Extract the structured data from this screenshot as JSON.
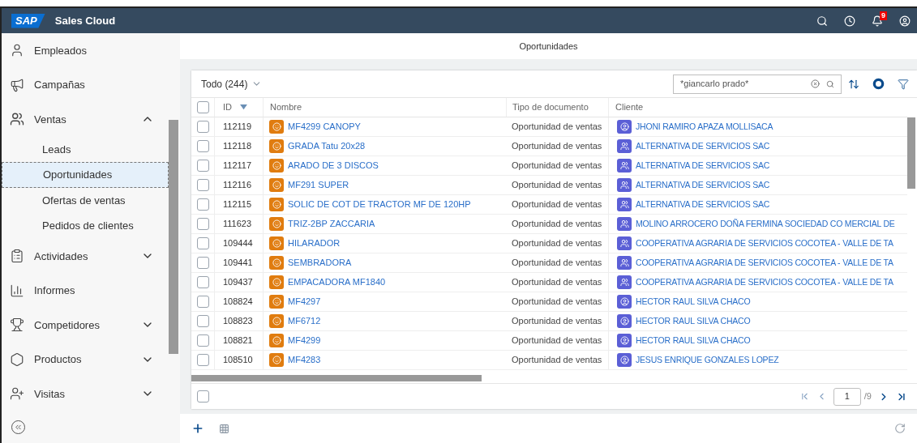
{
  "header": {
    "logo": "SAP",
    "title": "Sales Cloud",
    "notifications_count": "9"
  },
  "sidebar": {
    "items": [
      {
        "label": "Empleados",
        "selected": false
      },
      {
        "label": "Campañas",
        "selected": false
      },
      {
        "label": "Ventas",
        "selected": false,
        "expanded": true,
        "children": [
          {
            "label": "Leads",
            "selected": false
          },
          {
            "label": "Oportunidades",
            "selected": true
          },
          {
            "label": "Ofertas de ventas",
            "selected": false
          },
          {
            "label": "Pedidos de clientes",
            "selected": false
          }
        ]
      },
      {
        "label": "Actividades",
        "selected": false,
        "expanded": false
      },
      {
        "label": "Informes",
        "selected": false
      },
      {
        "label": "Competidores",
        "selected": false,
        "expanded": false
      },
      {
        "label": "Productos",
        "selected": false,
        "expanded": false
      },
      {
        "label": "Visitas",
        "selected": false,
        "expanded": false
      }
    ]
  },
  "page_title": "Oportunidades",
  "list": {
    "view": "Todo",
    "count": "(244)",
    "search": {
      "value": "*giancarlo prado*"
    },
    "columns": [
      "ID",
      "Nombre",
      "Tipo de documento",
      "Cliente"
    ],
    "header_checkbox": {
      "checked": false
    },
    "footer_checkbox": {
      "checked": false
    },
    "rows": [
      {
        "id": "112119",
        "name": "MF4299 CANOPY",
        "type": "Oportunidad de ventas",
        "client": "JHONI RAMIRO APAZA MOLLISACA",
        "kind": "person",
        "checked": false
      },
      {
        "id": "112118",
        "name": "GRADA Tatu 20x28",
        "type": "Oportunidad de ventas",
        "client": "ALTERNATIVA DE SERVICIOS SAC",
        "kind": "account",
        "checked": false
      },
      {
        "id": "112117",
        "name": "ARADO DE 3 DISCOS",
        "type": "Oportunidad de ventas",
        "client": "ALTERNATIVA DE SERVICIOS SAC",
        "kind": "account",
        "checked": false
      },
      {
        "id": "112116",
        "name": "MF291 SUPER",
        "type": "Oportunidad de ventas",
        "client": "ALTERNATIVA DE SERVICIOS SAC",
        "kind": "account",
        "checked": false
      },
      {
        "id": "112115",
        "name": "SOLIC DE COT DE TRACTOR MF DE 120HP",
        "type": "Oportunidad de ventas",
        "client": "ALTERNATIVA DE SERVICIOS SAC",
        "kind": "account",
        "checked": false
      },
      {
        "id": "111623",
        "name": "TRIZ-2BP ZACCARIA",
        "type": "Oportunidad de ventas",
        "client": "MOLINO ARROCERO DOÑA FERMINA SOCIEDAD CO MERCIAL DE",
        "kind": "account",
        "checked": false
      },
      {
        "id": "109444",
        "name": "HILARADOR",
        "type": "Oportunidad de ventas",
        "client": "COOPERATIVA AGRARIA DE SERVICIOS COCOTEA - VALLE DE TA",
        "kind": "account",
        "checked": false
      },
      {
        "id": "109441",
        "name": "SEMBRADORA",
        "type": "Oportunidad de ventas",
        "client": "COOPERATIVA AGRARIA DE SERVICIOS COCOTEA - VALLE DE TA",
        "kind": "account",
        "checked": false
      },
      {
        "id": "109437",
        "name": "EMPACADORA MF1840",
        "type": "Oportunidad de ventas",
        "client": "COOPERATIVA AGRARIA DE SERVICIOS COCOTEA - VALLE DE TA",
        "kind": "account",
        "checked": false
      },
      {
        "id": "108824",
        "name": "MF4297",
        "type": "Oportunidad de ventas",
        "client": "HECTOR RAUL SILVA CHACO",
        "kind": "person",
        "checked": false
      },
      {
        "id": "108823",
        "name": "MF6712",
        "type": "Oportunidad de ventas",
        "client": "HECTOR RAUL SILVA CHACO",
        "kind": "person",
        "checked": false
      },
      {
        "id": "108821",
        "name": "MF4299",
        "type": "Oportunidad de ventas",
        "client": "HECTOR RAUL SILVA CHACO",
        "kind": "person",
        "checked": false
      },
      {
        "id": "108510",
        "name": "MF4283",
        "type": "Oportunidad de ventas",
        "client": "JESUS ENRIQUE GONZALES LOPEZ",
        "kind": "person",
        "checked": false
      }
    ],
    "pagination": {
      "page": "1",
      "total": "/9"
    }
  }
}
